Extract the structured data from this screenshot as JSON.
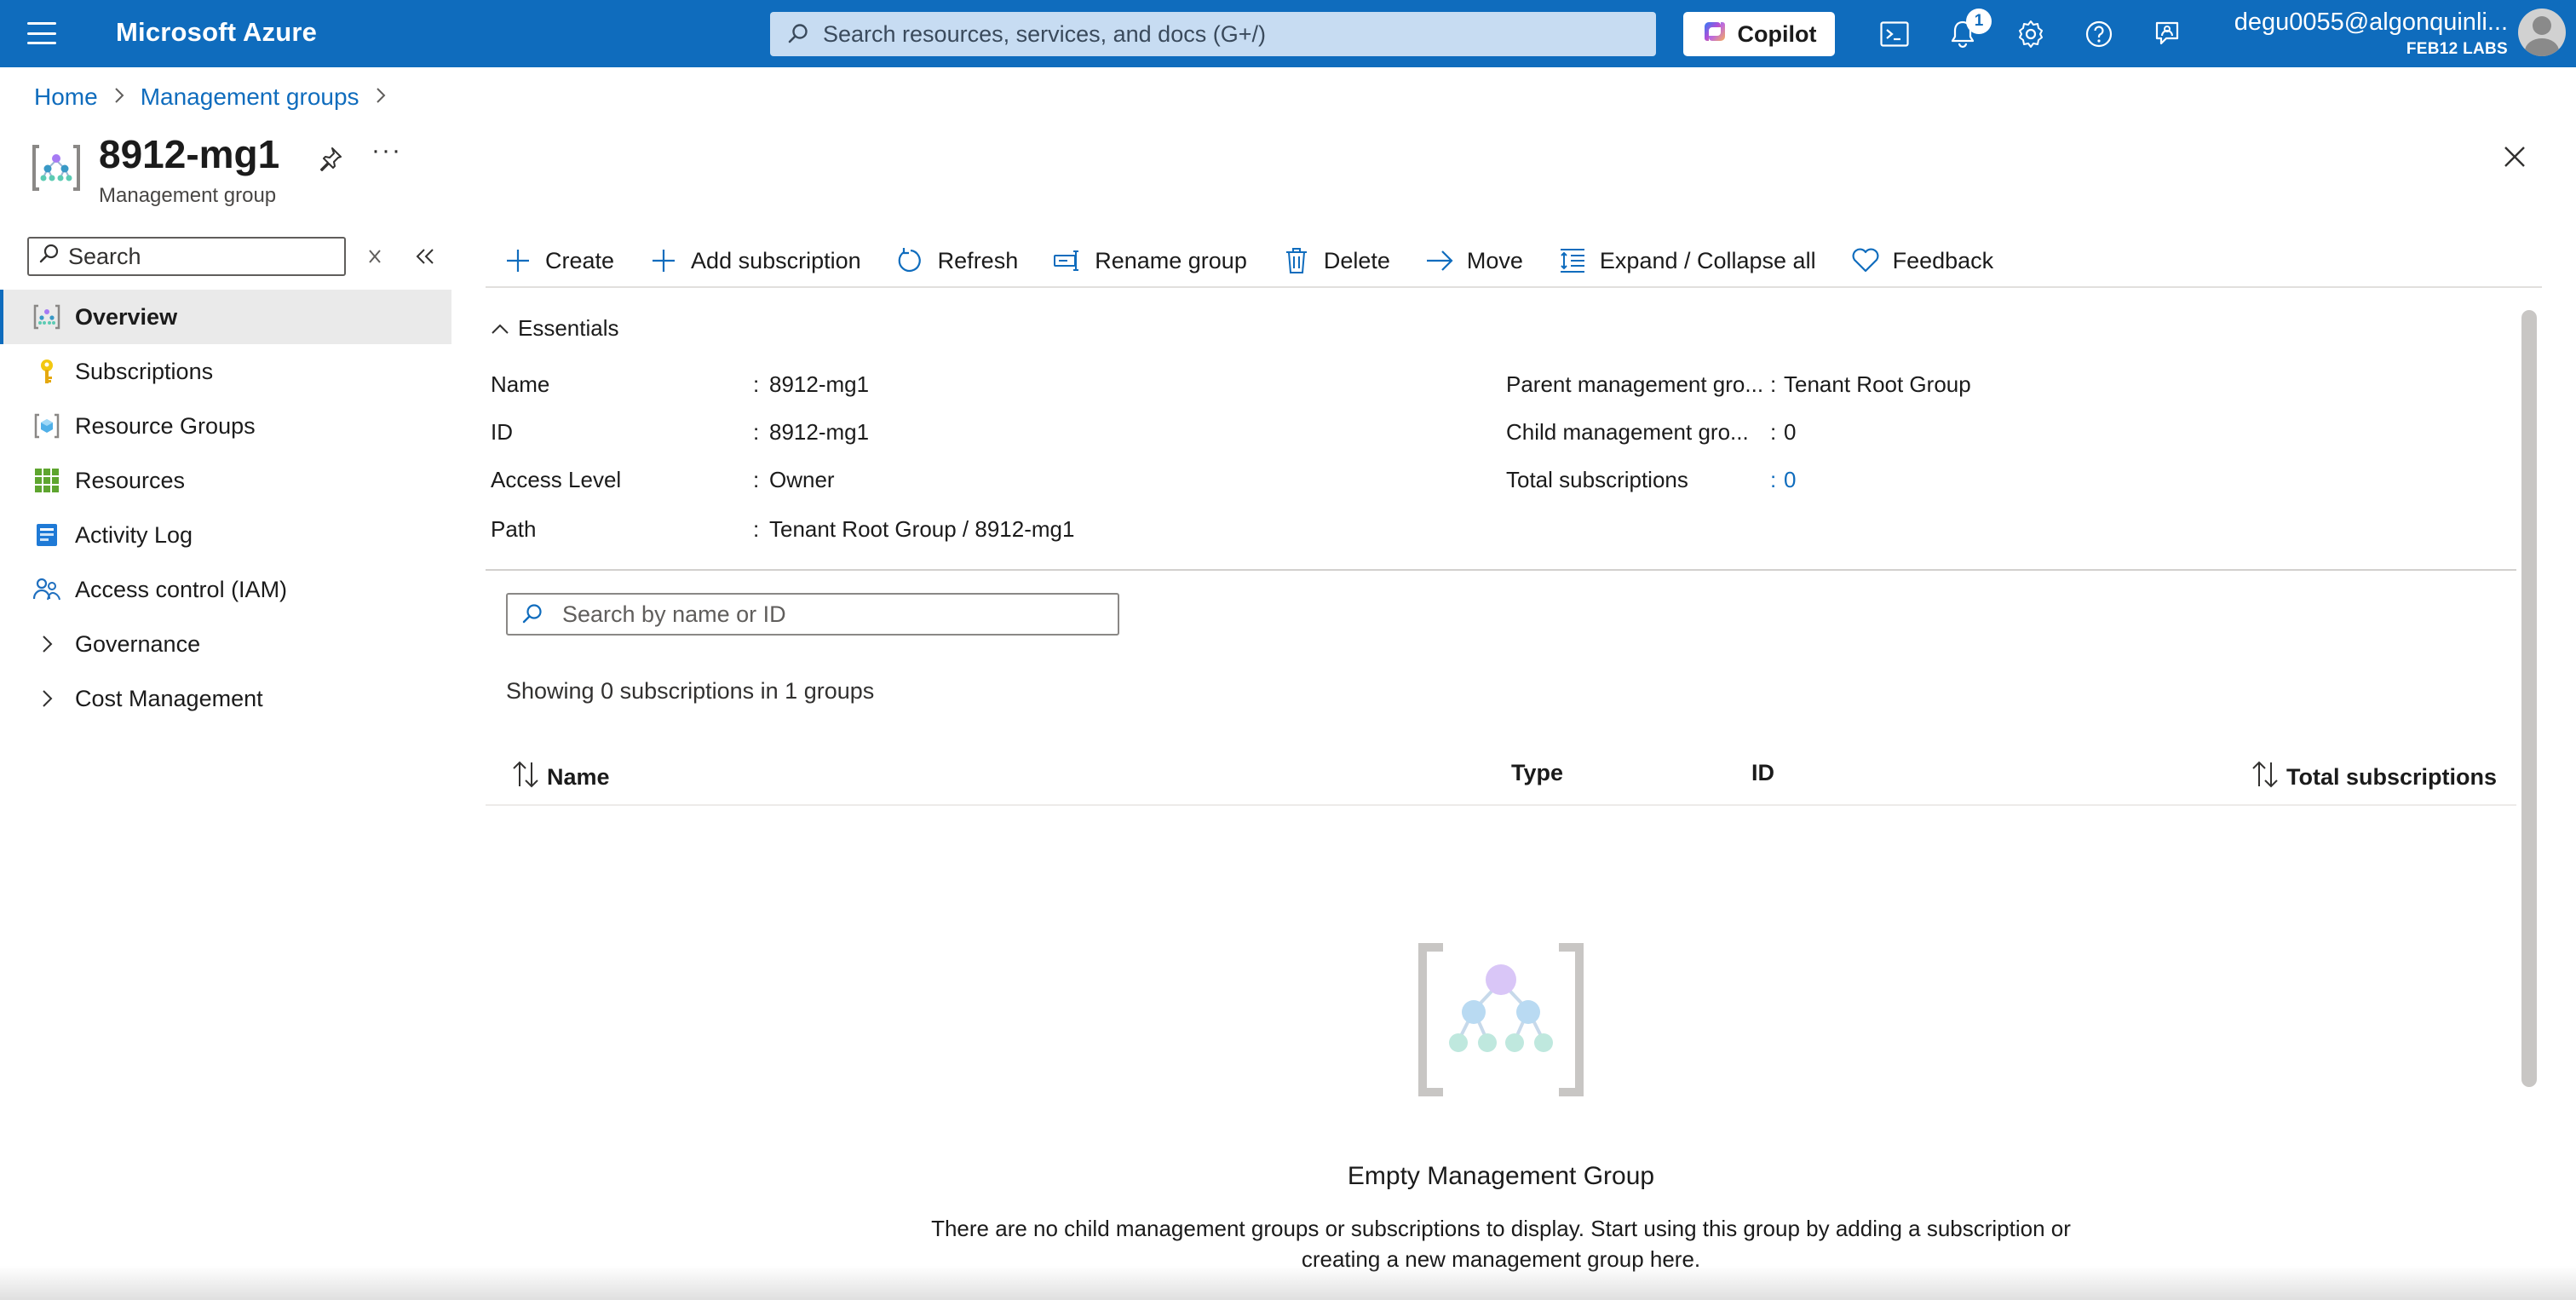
{
  "topbar": {
    "brand": "Microsoft Azure",
    "search_placeholder": "Search resources, services, and docs (G+/)",
    "copilot_label": "Copilot",
    "notification_count": "1",
    "account_email": "degu0055@algonquinli...",
    "account_tenant": "FEB12 LABS",
    "icons": [
      "menu-icon",
      "cloud-shell-icon",
      "bell-icon",
      "settings-icon",
      "help-icon",
      "feedback-icon"
    ]
  },
  "breadcrumb": {
    "items": [
      "Home",
      "Management groups"
    ]
  },
  "resource": {
    "title": "8912-mg1",
    "subtitle": "Management group",
    "more": "···"
  },
  "nav": {
    "search_placeholder": "Search",
    "items": [
      {
        "label": "Overview",
        "icon": "management-group-icon",
        "active": true
      },
      {
        "label": "Subscriptions",
        "icon": "key-icon"
      },
      {
        "label": "Resource Groups",
        "icon": "resource-group-icon"
      },
      {
        "label": "Resources",
        "icon": "grid-icon"
      },
      {
        "label": "Activity Log",
        "icon": "activity-log-icon"
      },
      {
        "label": "Access control (IAM)",
        "icon": "people-icon"
      },
      {
        "label": "Governance",
        "icon": "chevron-right-icon"
      },
      {
        "label": "Cost Management",
        "icon": "chevron-right-icon"
      }
    ]
  },
  "toolbar": {
    "create": "Create",
    "add_subscription": "Add subscription",
    "refresh": "Refresh",
    "rename_group": "Rename group",
    "delete": "Delete",
    "move": "Move",
    "expand_collapse": "Expand / Collapse all",
    "feedback": "Feedback"
  },
  "essentials": {
    "toggle_label": "Essentials",
    "left": [
      {
        "label": "Name",
        "value": "8912-mg1"
      },
      {
        "label": "ID",
        "value": "8912-mg1"
      },
      {
        "label": "Access Level",
        "value": "Owner"
      },
      {
        "label": "Path",
        "value": "Tenant Root Group / 8912-mg1"
      }
    ],
    "right": [
      {
        "label": "Parent management gro...",
        "value": "Tenant Root Group"
      },
      {
        "label": "Child management gro...",
        "value": "0"
      },
      {
        "label": "Total subscriptions",
        "value": "0"
      }
    ],
    "colon": ":"
  },
  "list": {
    "search_placeholder": "Search by name or ID",
    "showing_text": "Showing 0 subscriptions in 1 groups",
    "columns": {
      "name": "Name",
      "type": "Type",
      "id": "ID",
      "total": "Total subscriptions"
    }
  },
  "empty_state": {
    "title": "Empty Management Group",
    "text": "There are no child management groups or subscriptions to display. Start using this group by adding a subscription or creating a new management group here."
  },
  "colors": {
    "accent": "#0f6cbd",
    "nav_active_bg": "#eaeaea"
  }
}
